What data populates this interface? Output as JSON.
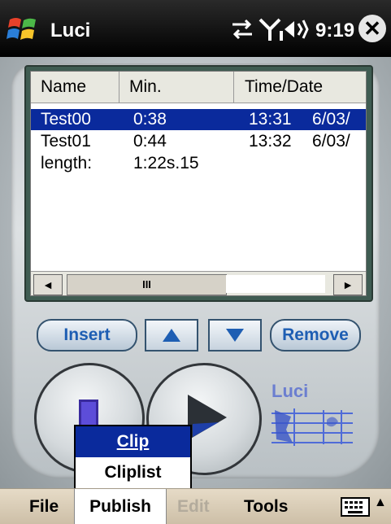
{
  "statusbar": {
    "title": "Luci",
    "time": "9:19",
    "icons": [
      "windows-start-icon",
      "connectivity-icon",
      "signal-icon",
      "volume-icon",
      "close-icon"
    ],
    "close_glyph": "✕"
  },
  "list": {
    "columns": [
      "Name",
      "Min.",
      "Time/Date"
    ],
    "rows": [
      {
        "name": "Test00",
        "min": "0:38",
        "time": "13:31",
        "date": "6/03/",
        "selected": true
      },
      {
        "name": "Test01",
        "min": "0:44",
        "time": "13:32",
        "date": "6/03/",
        "selected": false
      },
      {
        "name": "length:",
        "min": "1:22s.15",
        "time": "",
        "date": "",
        "selected": false
      }
    ],
    "scroll_left": "◄",
    "scroll_right": "►",
    "scroll_thumb": "III"
  },
  "controls": {
    "insert": "Insert",
    "remove": "Remove",
    "up_icon": "triangle-up-icon",
    "down_icon": "triangle-down-icon"
  },
  "logo": {
    "text": "Luci"
  },
  "popup": {
    "items": [
      {
        "label": "Clip",
        "underline": "C",
        "highlighted": true
      },
      {
        "label": "Cliplist",
        "underline": "C",
        "highlighted": false
      }
    ]
  },
  "menubar": {
    "file": "File",
    "publish": "Publish",
    "edit": "Edit",
    "tools": "Tools",
    "keyboard_icon": "keyboard-icon",
    "arrow": "▲"
  },
  "colors": {
    "selection": "#0a2a9c",
    "accent_blue": "#1e5eb3",
    "frame_green": "#3f5c52"
  }
}
